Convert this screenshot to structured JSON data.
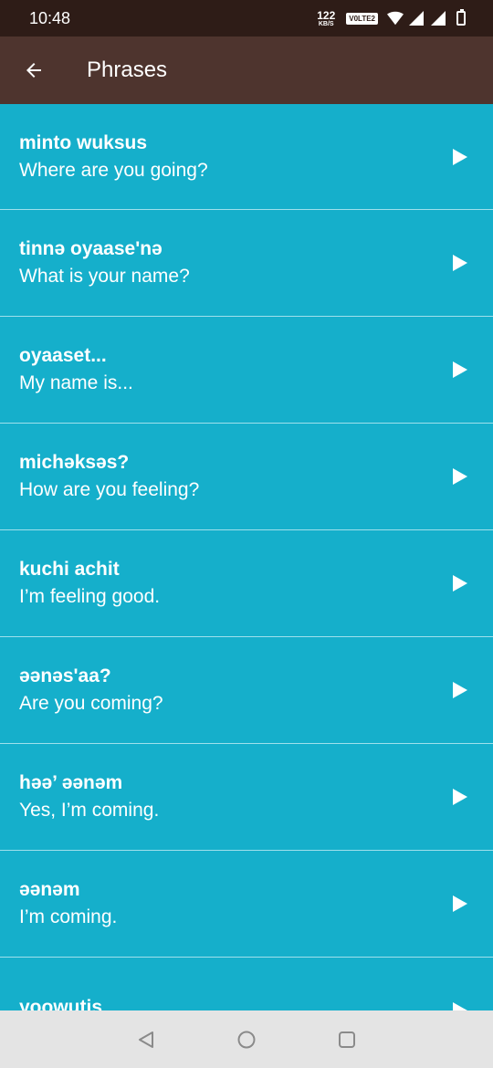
{
  "status_bar": {
    "time": "10:48",
    "net_speed": "122",
    "net_unit": "KB/S",
    "volte": "V0LTE2"
  },
  "header": {
    "title": "Phrases",
    "back_icon": "arrow-left-icon"
  },
  "phrases": [
    {
      "native": "minto wuksus",
      "english": "Where are you going?"
    },
    {
      "native": "tinnə oyaase'nə",
      "english": "What is your name?"
    },
    {
      "native": "oyaaset...",
      "english": "My name is..."
    },
    {
      "native": "michəksəs?",
      "english": "How are you feeling?"
    },
    {
      "native": "kuchi achit",
      "english": "I’m feeling good."
    },
    {
      "native": "əənəs'aa?",
      "english": "Are you coming?"
    },
    {
      "native": "həə’ əənəm",
      "english": "Yes, I’m coming."
    },
    {
      "native": "əənəm",
      "english": "I’m coming."
    },
    {
      "native": "yoowutis",
      "english": ""
    }
  ],
  "colors": {
    "list_background": "#15AFCB",
    "app_bar": "#4E342E",
    "status_bar": "#2E1C17",
    "divider": "#9FE0EC"
  }
}
